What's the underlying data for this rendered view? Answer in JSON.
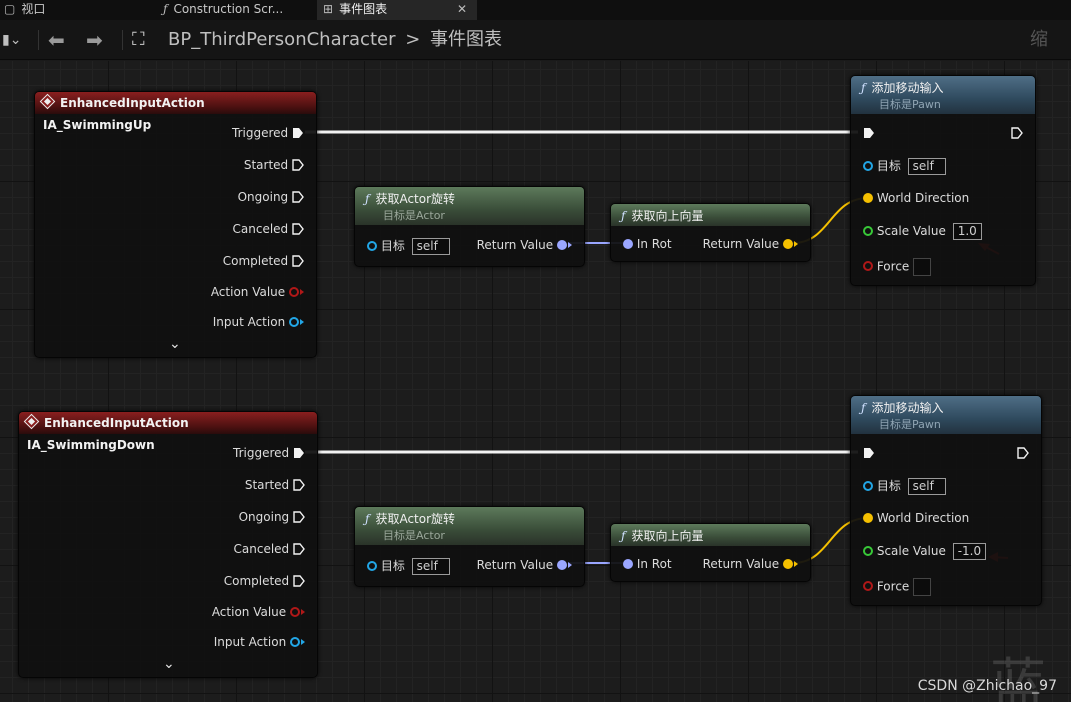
{
  "tabs": [
    {
      "label": "视口",
      "icon": "viewport-icon"
    },
    {
      "label": "Construction Scr...",
      "icon": "function-icon"
    },
    {
      "label": "事件图表",
      "icon": "graph-icon",
      "close": "✕"
    }
  ],
  "breadcrumb": {
    "blueprint": "BP_ThirdPersonCharacter",
    "separator": ">",
    "graph": "事件图表",
    "right_glyph": "缩"
  },
  "event_nodes": [
    {
      "title": "EnhancedInputAction IA_SwimmingUp",
      "pins": [
        "Triggered",
        "Started",
        "Ongoing",
        "Canceled",
        "Completed",
        "Action Value",
        "Input Action"
      ],
      "expand": "⌄"
    },
    {
      "title": "EnhancedInputAction IA_SwimmingDown",
      "pins": [
        "Triggered",
        "Started",
        "Ongoing",
        "Canceled",
        "Completed",
        "Action Value",
        "Input Action"
      ],
      "expand": "⌄"
    }
  ],
  "get_rotation_nodes": [
    {
      "fn": "ƒ",
      "title": "获取Actor旋转",
      "subtitle": "目标是Actor",
      "target_label": "目标",
      "target_value": "self",
      "output": "Return Value"
    },
    {
      "fn": "ƒ",
      "title": "获取Actor旋转",
      "subtitle": "目标是Actor",
      "target_label": "目标",
      "target_value": "self",
      "output": "Return Value"
    }
  ],
  "get_up_vector_nodes": [
    {
      "fn": "ƒ",
      "title": "获取向上向量",
      "input": "In Rot",
      "output": "Return Value"
    },
    {
      "fn": "ƒ",
      "title": "获取向上向量",
      "input": "In Rot",
      "output": "Return Value"
    }
  ],
  "add_movement_nodes": [
    {
      "fn": "ƒ",
      "title": "添加移动输入",
      "subtitle": "目标是Pawn",
      "target_label": "目标",
      "target_value": "self",
      "direction_label": "World Direction",
      "scale_label": "Scale Value",
      "scale_value": "1.0",
      "force_label": "Force",
      "force_checked": false
    },
    {
      "fn": "ƒ",
      "title": "添加移动输入",
      "subtitle": "目标是Pawn",
      "target_label": "目标",
      "target_value": "self",
      "direction_label": "World Direction",
      "scale_label": "Scale Value",
      "scale_value": "-1.0",
      "force_label": "Force",
      "force_checked": false
    }
  ],
  "colors": {
    "exec_wire": "#ffffff",
    "rotator_wire": "#9aa6ff",
    "vector_wire": "#f5c000",
    "annotation_arrow": "#e8201a",
    "event_header": "#8a1f1f",
    "pure_header": "#3a4d39",
    "call_header": "#2f4a5e"
  },
  "watermark": "CSDN @Zhichao_97",
  "background_glyph": "蓝"
}
